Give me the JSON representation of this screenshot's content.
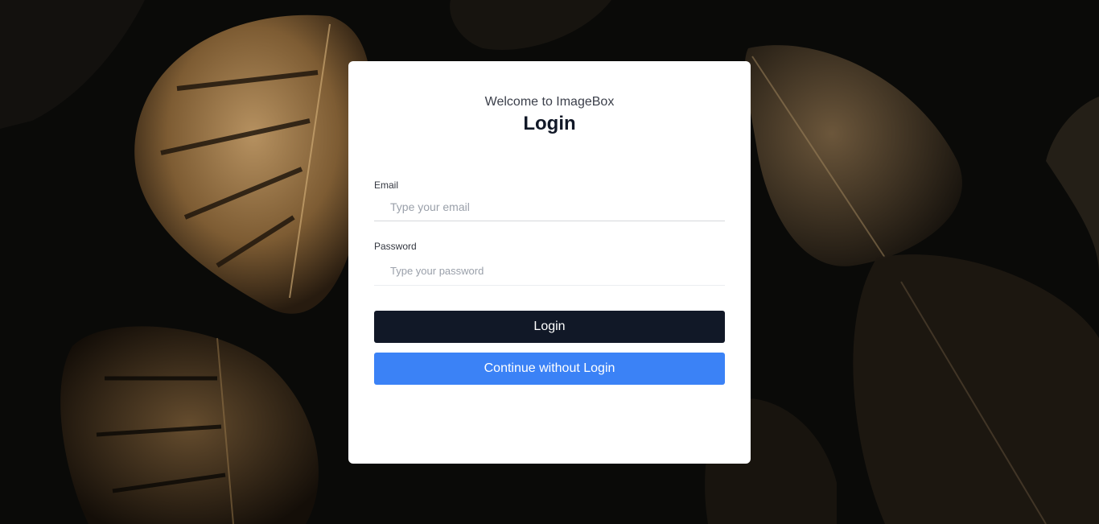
{
  "login_card": {
    "welcome_text": "Welcome to ImageBox",
    "title": "Login",
    "email": {
      "label": "Email",
      "placeholder": "Type your email",
      "value": ""
    },
    "password": {
      "label": "Password",
      "placeholder": "Type your password",
      "value": ""
    },
    "login_button": "Login",
    "guest_button": "Continue without Login"
  },
  "colors": {
    "background": "#0a0a08",
    "card": "#ffffff",
    "login_button": "#111827",
    "guest_button": "#3b82f6",
    "leaf_gold": "#b08a55"
  }
}
